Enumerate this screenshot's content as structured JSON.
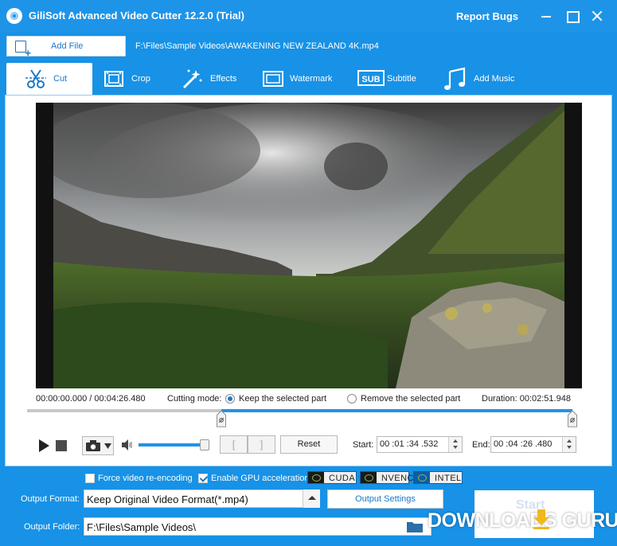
{
  "app": {
    "title": "GiliSoft Advanced Video Cutter 12.2.0 (Trial)",
    "report_bugs": "Report Bugs"
  },
  "file": {
    "add_file_label": "Add File",
    "path": "F:\\Files\\Sample Videos\\AWAKENING  NEW ZEALAND 4K.mp4"
  },
  "tabs": [
    {
      "label": "Cut",
      "icon": "scissors-icon",
      "active": true
    },
    {
      "label": "Crop",
      "icon": "film-crop-icon"
    },
    {
      "label": "Effects",
      "icon": "magic-wand-icon"
    },
    {
      "label": "Watermark",
      "icon": "watermark-frame-icon"
    },
    {
      "label": "Subtitle",
      "icon": "sub-icon"
    },
    {
      "label": "Add Music",
      "icon": "music-note-icon"
    }
  ],
  "sub_icon_text": "SUB",
  "player": {
    "time_current": "00:00:00.000",
    "time_separator": "/",
    "time_total": "00:04:26.480",
    "cutting_mode_label": "Cutting mode:",
    "mode_keep": "Keep the selected part",
    "mode_remove": "Remove the selected part",
    "selected_mode": "keep",
    "duration_label": "Duration:",
    "duration_value": "00:02:51.948",
    "selection_start_fraction": 0.356,
    "selection_end_fraction": 1.0,
    "volume_fraction": 0.96,
    "mark_in_label": "[",
    "mark_out_label": "]",
    "reset_label": "Reset",
    "start_label": "Start:",
    "start_value": "00 :01 :34 .532",
    "end_label": "End:",
    "end_value": "00 :04 :26 .480"
  },
  "options": {
    "force_reencode_label": "Force video re-encoding",
    "force_reencode_checked": false,
    "gpu_accel_label": "Enable GPU acceleration",
    "gpu_accel_checked": true,
    "gpu_badges": [
      "CUDA",
      "NVENC",
      "INTEL"
    ]
  },
  "output": {
    "format_label": "Output Format:",
    "format_value": "Keep Original Video Format(*.mp4)",
    "settings_label": "Output Settings",
    "folder_label": "Output Folder:",
    "folder_value": "F:\\Files\\Sample Videos\\",
    "start_label": "Start"
  },
  "watermark": "DOWNLOADS GURU",
  "colors": {
    "brand_blue": "#1e94e8",
    "accent": "#1b78c9"
  }
}
